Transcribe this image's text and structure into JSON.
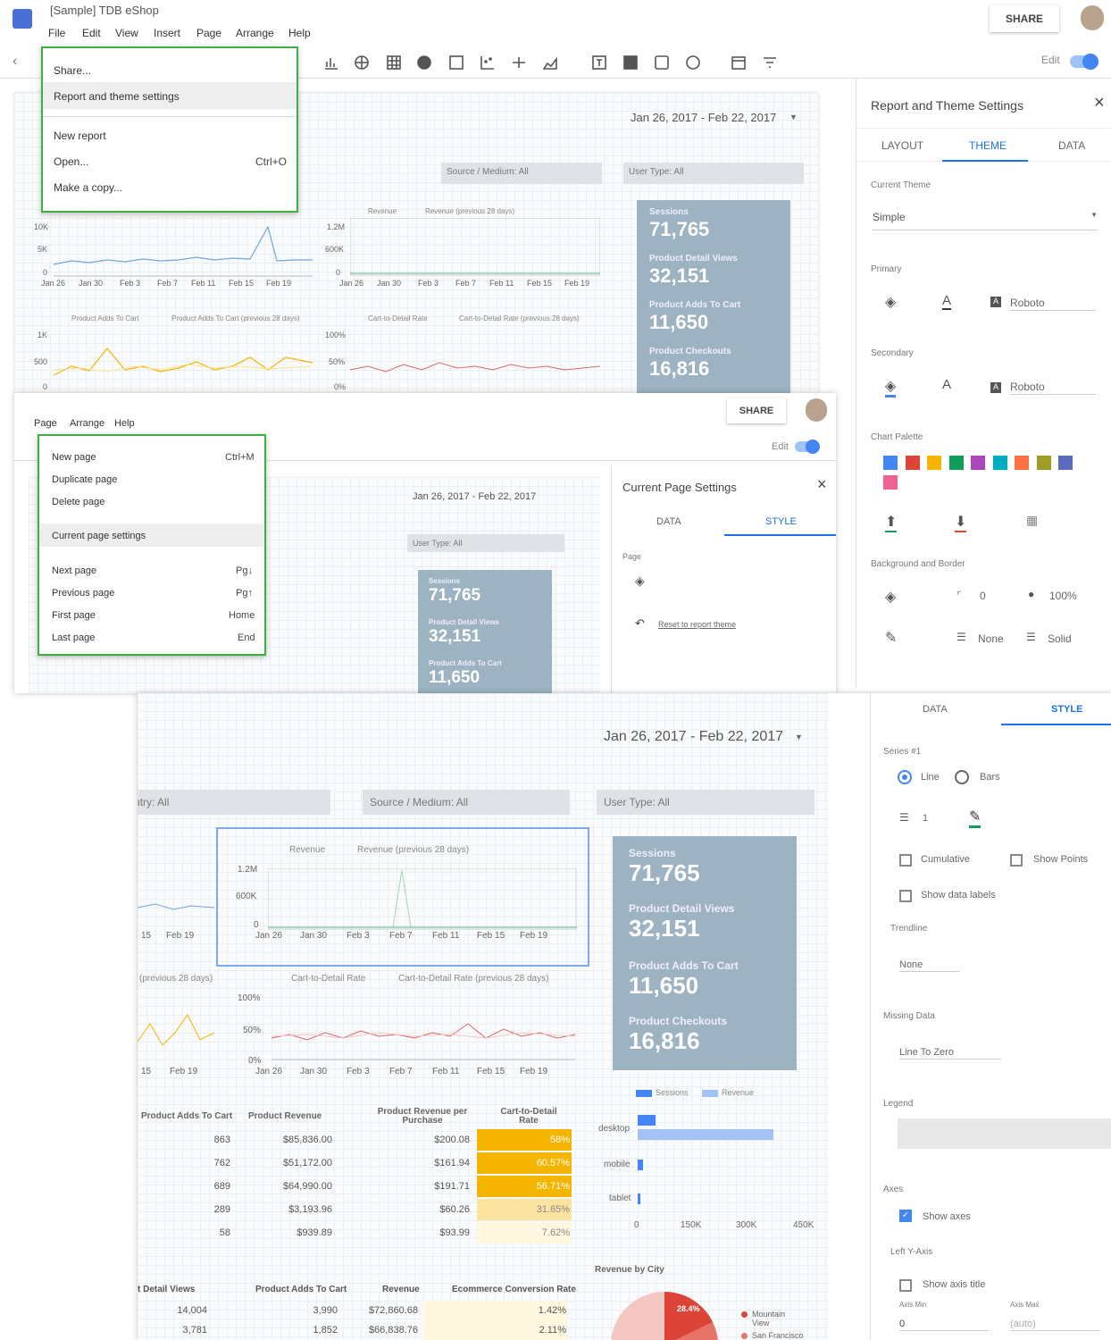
{
  "app": {
    "title": "[Sample] TDB eShop",
    "share": "SHARE",
    "edit_label": "Edit"
  },
  "menubar": [
    "File",
    "Edit",
    "View",
    "Insert",
    "Page",
    "Arrange",
    "Help"
  ],
  "file_menu": [
    "Share...",
    "Report and theme settings",
    "New report",
    "Open...",
    "Make a copy..."
  ],
  "file_shortcut": "Ctrl+O",
  "date_range": "Jan 26, 2017 - Feb 22, 2017",
  "filters": {
    "country": "Country: All",
    "source": "Source / Medium: All",
    "user": "User Type: All"
  },
  "kpis": [
    {
      "label": "Sessions",
      "value": "71,765"
    },
    {
      "label": "Product Detail Views",
      "value": "32,151"
    },
    {
      "label": "Product Adds To Cart",
      "value": "11,650"
    },
    {
      "label": "Product Checkouts",
      "value": "16,816"
    }
  ],
  "chart_ticks": {
    "y1": [
      "10K",
      "5K",
      "0"
    ],
    "y2": [
      "1.2M",
      "600K",
      "0"
    ],
    "y3": [
      "1K",
      "500",
      "0"
    ],
    "y4": [
      "100%",
      "50%",
      "0%"
    ],
    "x": [
      "Jan 26",
      "Jan 30",
      "Feb 3",
      "Feb 7",
      "Feb 11",
      "Feb 15",
      "Feb 19"
    ]
  },
  "legends": {
    "rev": "Revenue",
    "rev_prev": "Revenue (previous 28 days)",
    "adds": "Product Adds To Cart",
    "adds_prev": "Product Adds To Cart (previous 28 days)",
    "ctd": "Cart-to-Detail Rate",
    "ctd_prev": "Cart-to-Detail Rate (previous 28 days)"
  },
  "theme_panel": {
    "title": "Report and Theme Settings",
    "tabs": [
      "LAYOUT",
      "THEME",
      "DATA"
    ],
    "current_theme_label": "Current Theme",
    "current_theme": "Simple",
    "primary": "Primary",
    "secondary": "Secondary",
    "font": "Roboto",
    "palette_label": "Chart Palette",
    "palette": [
      "#4285f4",
      "#db4437",
      "#f4b400",
      "#0f9d58",
      "#ab47bc",
      "#00acc1",
      "#ff7043",
      "#9e9d24",
      "#5c6bc0",
      "#f06292"
    ],
    "bg_label": "Background and Border",
    "radius": "0",
    "opacity": "100%",
    "border_none": "None",
    "border_solid": "Solid"
  },
  "page_menu": {
    "menubar": [
      "Page",
      "Arrange",
      "Help"
    ],
    "items": [
      "New page",
      "Duplicate page",
      "Delete page",
      "Current page settings",
      "Next page",
      "Previous page",
      "First page",
      "Last page"
    ],
    "shortcuts": [
      "Ctrl+M",
      "Pg↓",
      "Pg↑",
      "Home",
      "End"
    ]
  },
  "page_panel": {
    "title": "Current Page Settings",
    "tabs": [
      "DATA",
      "STYLE"
    ],
    "page_label": "Page",
    "reset": "Reset to report theme"
  },
  "style_panel": {
    "tabs": [
      "DATA",
      "STYLE"
    ],
    "series": "Series #1",
    "line": "Line",
    "bars": "Bars",
    "weight": "1",
    "cumulative": "Cumulative",
    "show_points": "Show Points",
    "data_labels": "Show data labels",
    "trendline": "Trendline",
    "trend_val": "None",
    "missing": "Missing Data",
    "missing_val": "Line To Zero",
    "legend": "Legend",
    "axes": "Axes",
    "show_axes": "Show axes",
    "left_y": "Left Y-Axis",
    "axis_title": "Show axis title",
    "axis_min": "Axis Min",
    "axis_max": "Axis Max",
    "min_val": "0",
    "max_val": "(auto)"
  },
  "table1": {
    "headers": [
      "Product Adds To Cart",
      "Product Revenue",
      "Product Revenue per Purchase",
      "Cart-to-Detail Rate"
    ],
    "rows": [
      [
        "863",
        "$85,836.00",
        "$200.08",
        "58%"
      ],
      [
        "762",
        "$51,172.00",
        "$161.94",
        "60.57%"
      ],
      [
        "689",
        "$64,990.00",
        "$191.71",
        "56.71%"
      ],
      [
        "289",
        "$3,193.96",
        "$60.26",
        "31.65%"
      ],
      [
        "58",
        "$939.89",
        "$93.99",
        "7.62%"
      ]
    ]
  },
  "table2": {
    "headers": [
      "t Detail Views",
      "Product Adds To Cart",
      "Revenue",
      "Ecommerce Conversion Rate"
    ],
    "rows": [
      [
        "14,004",
        "3,990",
        "$72,860.68",
        "1.42%"
      ],
      [
        "3,781",
        "1,852",
        "$66,838.76",
        "2.11%"
      ]
    ]
  },
  "bar_chart": {
    "legend": [
      "Sessions",
      "Revenue"
    ],
    "categories": [
      "desktop",
      "mobile",
      "tablet"
    ],
    "x_ticks": [
      "0",
      "150K",
      "300K",
      "450K"
    ]
  },
  "city_chart": {
    "title": "Revenue by City",
    "slice": "28.4%",
    "legend": [
      "Mountain View",
      "San Francisco"
    ]
  },
  "big_chart": {
    "ticks_x2": [
      "Jan 26",
      "Jan 30",
      "Feb 3",
      "Feb 7",
      "Feb 11",
      "Feb 15",
      "Feb 19"
    ],
    "left_ticks": [
      "15",
      "Feb 19"
    ],
    "prev_label": "(previous 28 days)"
  }
}
